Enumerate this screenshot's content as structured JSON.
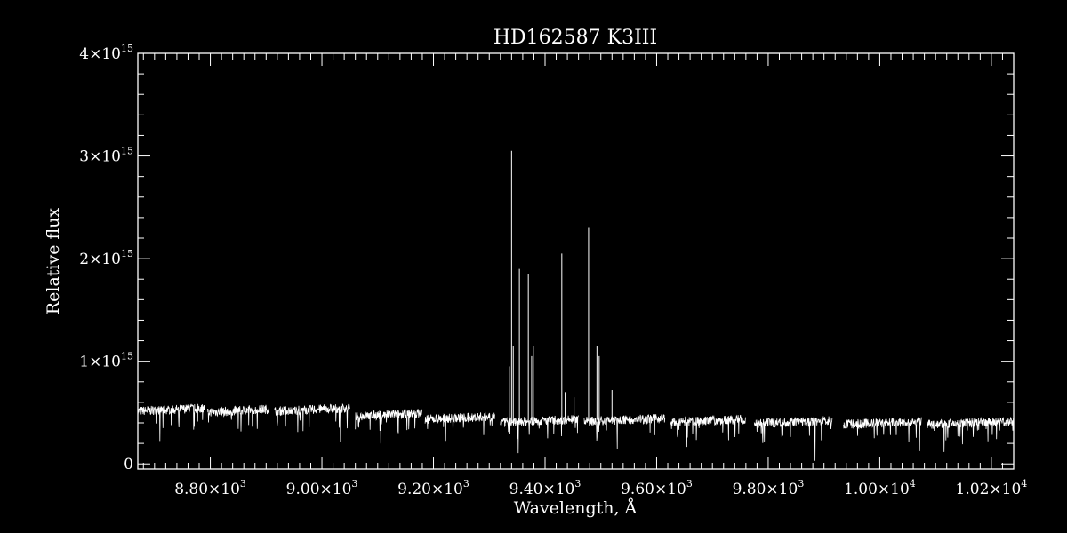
{
  "chart_data": {
    "type": "line",
    "title": "HD162587   K3III",
    "xlabel": "Wavelength, Å",
    "ylabel": "Relative flux",
    "xlim": [
      8670,
      10240
    ],
    "ylim": [
      -50000000000000.0,
      4000000000000000.0
    ],
    "xticks": [
      {
        "value": 8800,
        "mant": "8.80×10",
        "exp": "3"
      },
      {
        "value": 9000,
        "mant": "9.00×10",
        "exp": "3"
      },
      {
        "value": 9200,
        "mant": "9.20×10",
        "exp": "3"
      },
      {
        "value": 9400,
        "mant": "9.40×10",
        "exp": "3"
      },
      {
        "value": 9600,
        "mant": "9.60×10",
        "exp": "3"
      },
      {
        "value": 9800,
        "mant": "9.80×10",
        "exp": "3"
      },
      {
        "value": 10000,
        "mant": "1.00×10",
        "exp": "4"
      },
      {
        "value": 10200,
        "mant": "1.02×10",
        "exp": "4"
      }
    ],
    "yticks": [
      {
        "value": 0,
        "mant": "0",
        "exp": ""
      },
      {
        "value": 1000000000000000.0,
        "mant": "1×10",
        "exp": "15"
      },
      {
        "value": 2000000000000000.0,
        "mant": "2×10",
        "exp": "15"
      },
      {
        "value": 3000000000000000.0,
        "mant": "3×10",
        "exp": "15"
      },
      {
        "value": 4000000000000000.0,
        "mant": "4×10",
        "exp": "15"
      }
    ],
    "grid": false,
    "series_color": "#ffffff",
    "segments": [
      {
        "x0": 8670,
        "x1": 8790,
        "level": 530000000000000.0
      },
      {
        "x0": 8795,
        "x1": 8905,
        "level": 520000000000000.0
      },
      {
        "x0": 8915,
        "x1": 9050,
        "level": 530000000000000.0
      },
      {
        "x0": 9060,
        "x1": 9180,
        "level": 480000000000000.0
      },
      {
        "x0": 9185,
        "x1": 9310,
        "level": 450000000000000.0
      },
      {
        "x0": 9320,
        "x1": 9460,
        "level": 420000000000000.0
      },
      {
        "x0": 9470,
        "x1": 9615,
        "level": 430000000000000.0
      },
      {
        "x0": 9625,
        "x1": 9760,
        "level": 420000000000000.0
      },
      {
        "x0": 9775,
        "x1": 9915,
        "level": 410000000000000.0
      },
      {
        "x0": 9935,
        "x1": 10075,
        "level": 400000000000000.0
      },
      {
        "x0": 10085,
        "x1": 10240,
        "level": 400000000000000.0
      }
    ],
    "spikes": [
      {
        "x": 9340,
        "y": 3050000000000000.0
      },
      {
        "x": 9343,
        "y": 1150000000000000.0
      },
      {
        "x": 9336,
        "y": 950000000000000.0
      },
      {
        "x": 9354,
        "y": 1900000000000000.0
      },
      {
        "x": 9370,
        "y": 1850000000000000.0
      },
      {
        "x": 9376,
        "y": 1050000000000000.0
      },
      {
        "x": 9379,
        "y": 1150000000000000.0
      },
      {
        "x": 9430,
        "y": 2050000000000000.0
      },
      {
        "x": 9436,
        "y": 700000000000000.0
      },
      {
        "x": 9452,
        "y": 650000000000000.0
      },
      {
        "x": 9478,
        "y": 2300000000000000.0
      },
      {
        "x": 9493,
        "y": 1150000000000000.0
      },
      {
        "x": 9497,
        "y": 1050000000000000.0
      },
      {
        "x": 9520,
        "y": 720000000000000.0
      }
    ]
  }
}
